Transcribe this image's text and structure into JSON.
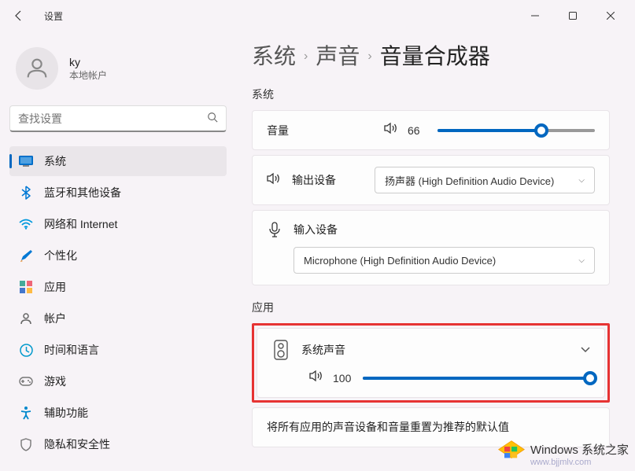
{
  "window": {
    "title": "设置"
  },
  "profile": {
    "name": "ky",
    "subtitle": "本地帐户"
  },
  "search": {
    "placeholder": "查找设置"
  },
  "nav": {
    "items": [
      {
        "label": "系统",
        "active": true
      },
      {
        "label": "蓝牙和其他设备",
        "active": false
      },
      {
        "label": "网络和 Internet",
        "active": false
      },
      {
        "label": "个性化",
        "active": false
      },
      {
        "label": "应用",
        "active": false
      },
      {
        "label": "帐户",
        "active": false
      },
      {
        "label": "时间和语言",
        "active": false
      },
      {
        "label": "游戏",
        "active": false
      },
      {
        "label": "辅助功能",
        "active": false
      },
      {
        "label": "隐私和安全性",
        "active": false
      }
    ]
  },
  "breadcrumb": {
    "items": [
      "系统",
      "声音",
      "音量合成器"
    ]
  },
  "sections": {
    "system": {
      "title": "系统",
      "volume": {
        "label": "音量",
        "value": 66
      },
      "output": {
        "label": "输出设备",
        "value": "扬声器 (High Definition Audio Device)"
      },
      "input": {
        "label": "输入设备",
        "value": "Microphone (High Definition Audio Device)"
      }
    },
    "apps": {
      "title": "应用",
      "systemSound": {
        "label": "系统声音",
        "value": 100
      },
      "reset": {
        "text": "将所有应用的声音设备和音量重置为推荐的默认值"
      }
    }
  },
  "watermark": {
    "main": "Windows 系统之家",
    "sub": "www.bjjmlv.com"
  }
}
